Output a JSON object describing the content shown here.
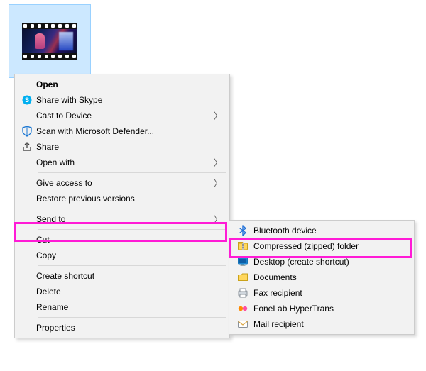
{
  "file_thumbnail": {
    "type": "video",
    "selected": true
  },
  "context_menu": {
    "open": {
      "label": "Open",
      "bold": true
    },
    "share_skype": {
      "label": "Share with Skype",
      "icon": "skype-icon"
    },
    "cast": {
      "label": "Cast to Device",
      "submenu": true
    },
    "defender": {
      "label": "Scan with Microsoft Defender...",
      "icon": "shield-icon"
    },
    "share": {
      "label": "Share",
      "icon": "share-icon"
    },
    "open_with": {
      "label": "Open with",
      "submenu": true
    },
    "give_access": {
      "label": "Give access to",
      "submenu": true
    },
    "restore_prev": {
      "label": "Restore previous versions"
    },
    "send_to": {
      "label": "Send to",
      "submenu": true,
      "highlighted": true
    },
    "cut": {
      "label": "Cut"
    },
    "copy": {
      "label": "Copy"
    },
    "create_shortcut": {
      "label": "Create shortcut"
    },
    "delete": {
      "label": "Delete"
    },
    "rename": {
      "label": "Rename"
    },
    "properties": {
      "label": "Properties"
    }
  },
  "send_to_submenu": {
    "bluetooth": {
      "label": "Bluetooth device",
      "icon": "bluetooth-icon"
    },
    "zip": {
      "label": "Compressed (zipped) folder",
      "icon": "zip-icon",
      "highlighted": true
    },
    "desktop": {
      "label": "Desktop (create shortcut)",
      "icon": "desktop-icon"
    },
    "documents": {
      "label": "Documents",
      "icon": "folder-icon"
    },
    "fax": {
      "label": "Fax recipient",
      "icon": "fax-icon"
    },
    "fonelab": {
      "label": "FoneLab HyperTrans",
      "icon": "fonelab-icon"
    },
    "mail": {
      "label": "Mail recipient",
      "icon": "mail-icon"
    }
  },
  "highlight_color": "#ff1bd6"
}
